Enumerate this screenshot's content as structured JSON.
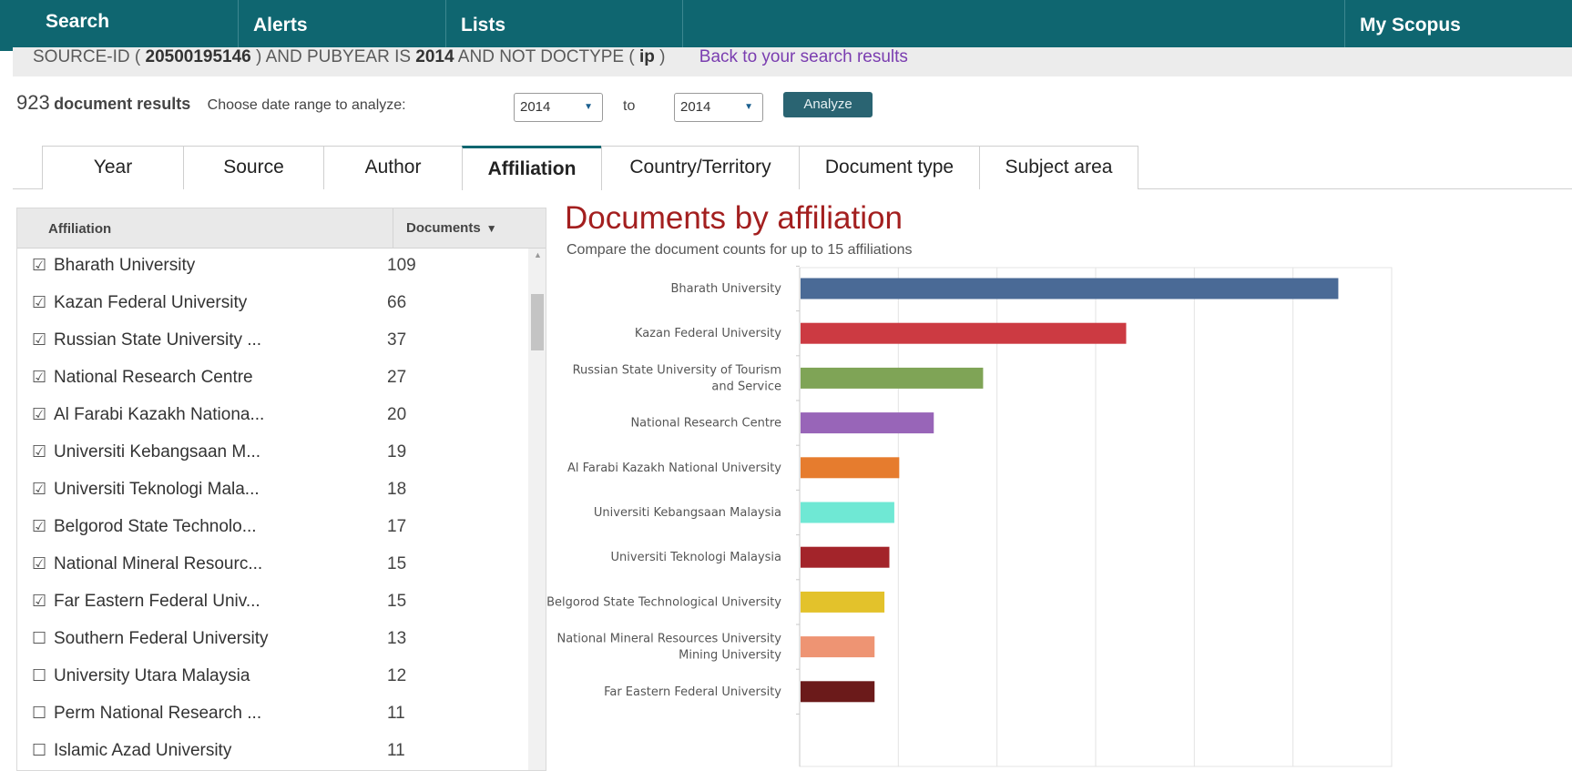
{
  "nav": {
    "search": "Search",
    "alerts": "Alerts",
    "lists": "Lists",
    "my_scopus": "My Scopus"
  },
  "query": {
    "prefix": "SOURCE-ID ( ",
    "source_id": "20500195146",
    "mid1": " ) AND PUBYEAR IS ",
    "year": "2014",
    "mid2": " AND NOT DOCTYPE ( ",
    "doctype": "ip",
    "suffix": " )",
    "back_link": "Back to your search results"
  },
  "results": {
    "count": "923",
    "label": "document results",
    "range_label": "Choose date range to analyze:",
    "from_year": "2014",
    "to_label": "to",
    "to_year": "2014",
    "analyze_button": "Analyze"
  },
  "tabs": [
    "Year",
    "Source",
    "Author",
    "Affiliation",
    "Country/Territory",
    "Document type",
    "Subject area"
  ],
  "active_tab": "Affiliation",
  "table": {
    "header_affiliation": "Affiliation",
    "header_documents": "Documents",
    "rows": [
      {
        "name": "Bharath University",
        "count": "109",
        "checked": true
      },
      {
        "name": "Kazan Federal University",
        "count": "66",
        "checked": true
      },
      {
        "name": "Russian State University ...",
        "count": "37",
        "checked": true
      },
      {
        "name": "National Research Centre",
        "count": "27",
        "checked": true
      },
      {
        "name": "Al Farabi Kazakh Nationa...",
        "count": "20",
        "checked": true
      },
      {
        "name": "Universiti Kebangsaan M...",
        "count": "19",
        "checked": true
      },
      {
        "name": "Universiti Teknologi Mala...",
        "count": "18",
        "checked": true
      },
      {
        "name": "Belgorod State Technolo...",
        "count": "17",
        "checked": true
      },
      {
        "name": "National Mineral Resourc...",
        "count": "15",
        "checked": true
      },
      {
        "name": "Far Eastern Federal Univ...",
        "count": "15",
        "checked": true
      },
      {
        "name": "Southern Federal University",
        "count": "13",
        "checked": false
      },
      {
        "name": "University Utara Malaysia",
        "count": "12",
        "checked": false
      },
      {
        "name": "Perm National Research ...",
        "count": "11",
        "checked": false
      },
      {
        "name": "Islamic Azad University",
        "count": "11",
        "checked": false
      }
    ]
  },
  "chart_data": {
    "type": "bar",
    "orientation": "horizontal",
    "title": "Documents by affiliation",
    "subtitle": "Compare the document counts for up to 15 affiliations",
    "categories": [
      "Bharath University",
      "Kazan Federal University",
      "Russian State University of Tourism and Service",
      "National Research Centre",
      "Al Farabi Kazakh National University",
      "Universiti Kebangsaan Malaysia",
      "Universiti Teknologi Malaysia",
      "Belgorod State Technological University",
      "National Mineral Resources University Mining University",
      "Far Eastern Federal University"
    ],
    "values": [
      109,
      66,
      37,
      27,
      20,
      19,
      18,
      17,
      15,
      15
    ],
    "colors": [
      "#4a6a96",
      "#cc3a42",
      "#7fa456",
      "#9865b8",
      "#e67c2e",
      "#6fe8d4",
      "#a3242a",
      "#e3c22b",
      "#ee9473",
      "#6b1a1a"
    ],
    "xlim": [
      0,
      120
    ],
    "grid": true
  }
}
